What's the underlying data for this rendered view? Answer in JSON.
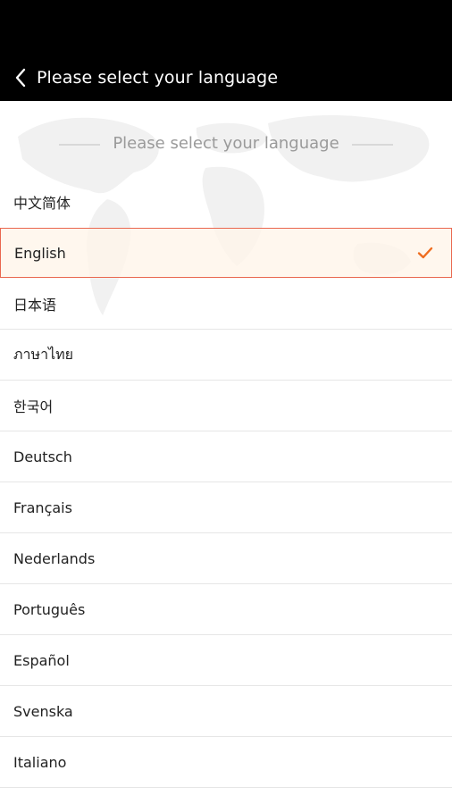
{
  "app_bar": {
    "title": "Please select your language"
  },
  "section_header": {
    "text": "Please select your language"
  },
  "languages": [
    {
      "label": "中文简体",
      "selected": false
    },
    {
      "label": "English",
      "selected": true
    },
    {
      "label": "日本语",
      "selected": false
    },
    {
      "label": "ภาษาไทย",
      "selected": false
    },
    {
      "label": "한국어",
      "selected": false
    },
    {
      "label": "Deutsch",
      "selected": false
    },
    {
      "label": "Français",
      "selected": false
    },
    {
      "label": "Nederlands",
      "selected": false
    },
    {
      "label": "Português",
      "selected": false
    },
    {
      "label": "Español",
      "selected": false
    },
    {
      "label": "Svenska",
      "selected": false
    },
    {
      "label": "Italiano",
      "selected": false
    }
  ],
  "icons": {
    "back": "chevron-left-icon",
    "check": "checkmark-icon"
  },
  "colors": {
    "accent": "#e9674f",
    "check": "#ef6c1e",
    "bar": "#000000"
  }
}
